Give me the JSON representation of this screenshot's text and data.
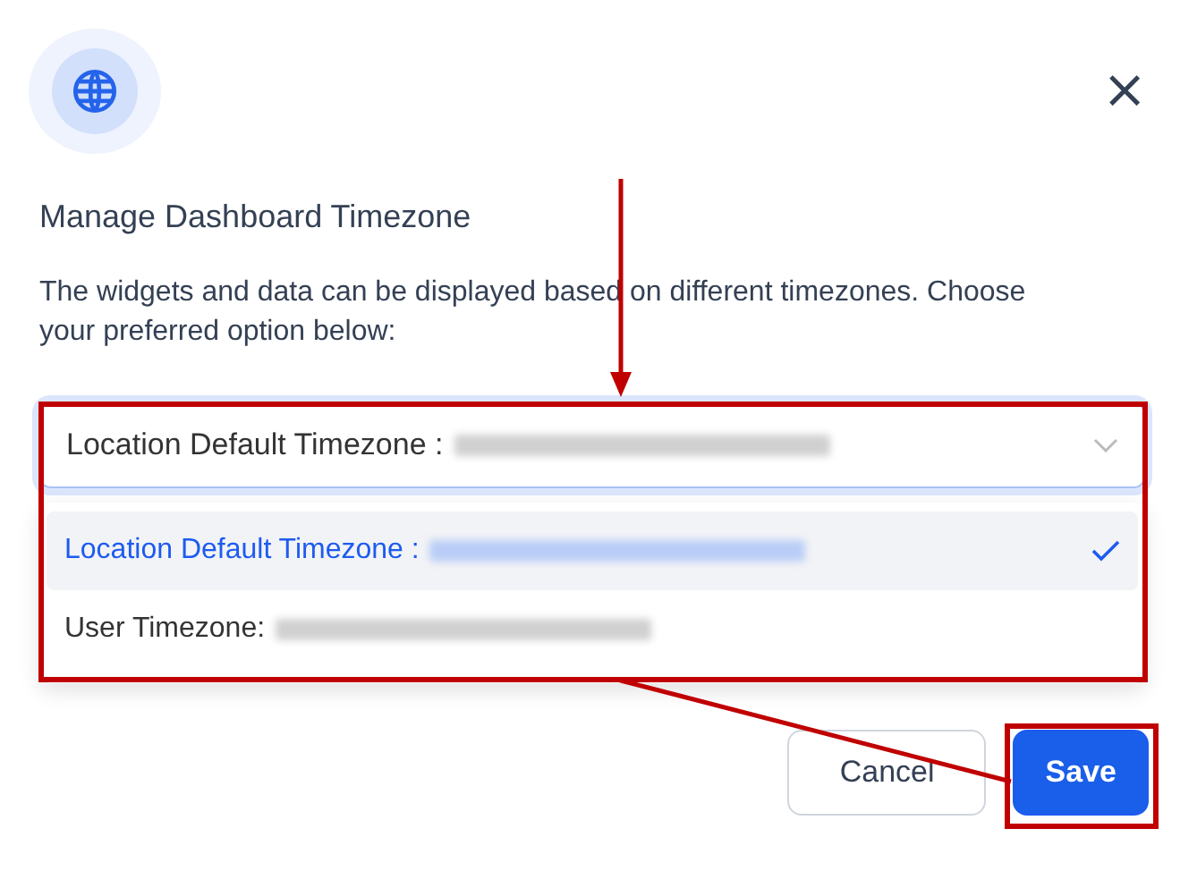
{
  "dialog": {
    "title": "Manage Dashboard Timezone",
    "description": "The widgets and data can be displayed based on different timezones. Choose your preferred option below:",
    "close": "×"
  },
  "select": {
    "label": "Location Default Timezone :",
    "value_redacted": true,
    "expanded": true
  },
  "options": [
    {
      "label": "Location Default Timezone :",
      "value_redacted": true,
      "selected": true
    },
    {
      "label": "User Timezone:",
      "value_redacted": true,
      "selected": false
    }
  ],
  "buttons": [
    {
      "label": "Cancel",
      "kind": "secondary"
    },
    {
      "label": "Save",
      "kind": "primary"
    }
  ],
  "annotations": {
    "highlight_boxes": true,
    "arrows": true
  }
}
